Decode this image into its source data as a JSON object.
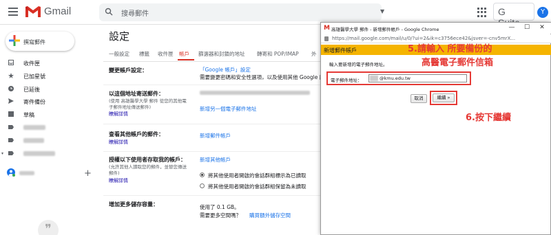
{
  "app": {
    "name": "Gmail",
    "suite_label": "G Suite",
    "avatar_letter": "Y"
  },
  "search": {
    "placeholder": "搜尋郵件"
  },
  "compose": {
    "label": "撰寫郵件"
  },
  "sidebar": {
    "items": [
      {
        "label": "收件匣",
        "icon": "inbox-icon"
      },
      {
        "label": "已加星號",
        "icon": "star-icon"
      },
      {
        "label": "已延後",
        "icon": "clock-icon"
      },
      {
        "label": "寄件備份",
        "icon": "send-icon"
      },
      {
        "label": "草稿",
        "icon": "draft-icon"
      }
    ]
  },
  "settings": {
    "title": "設定",
    "tabs": [
      "一般設定",
      "標籤",
      "收件匣",
      "帳戶",
      "篩選器和封鎖的地址",
      "轉寄和 POP/IMAP",
      "外"
    ],
    "active_tab": "帳戶",
    "rows": {
      "change": {
        "label": "變更帳戶設定：",
        "link": "「Google 帳戶」設定",
        "desc": "需要變更密碼和安全性選項，以及使用其他 Google 服"
      },
      "sendas": {
        "label": "以這個地址寄送郵件：",
        "sub1": "(使用 高雄醫學大學 郵件 從您的其他電",
        "sub2": "子郵件地址傳送郵件)",
        "learn": "瞭解詳情",
        "action": "新增另一個電子郵件地址"
      },
      "check": {
        "label": "查看其他帳戶的郵件：",
        "learn": "瞭解詳情",
        "action": "新增郵件帳戶"
      },
      "grant": {
        "label": "授權以下使用者存取我的帳戶：",
        "sub1": "(允許其他人讀取您的郵件，並替您傳送",
        "sub2": "郵件)",
        "learn": "瞭解詳情",
        "action": "新增其他帳戶",
        "opt1": "將其他使用者開啟的會話群組標示為已讀取",
        "opt2": "將其他使用者開啟的會話群組保留為未讀取"
      },
      "storage": {
        "label": "增加更多儲存容量：",
        "used": "使用了 0.1 GB。",
        "need": "需要更多空間嗎？",
        "buy": "購買額外儲存空間"
      }
    }
  },
  "popup": {
    "title": "高雄醫學大學 郵件 - 新增郵件帳戶 - Google Chrome",
    "url": "https://mail.google.com/mail/u/0/?ui=2&ik=c3756ece42&jsver=-cnv5mrX...",
    "header": "新增郵件帳戶",
    "instruction": "輸入要新增的電子郵件地址。",
    "email_label": "電子郵件地址：",
    "email_value": "@kmu.edu.tw",
    "cancel": "取消",
    "next": "繼續 »"
  },
  "annotations": {
    "step5_line1": "5.請輸入 所要備份的",
    "step5_line2": "高醫電子郵件信箱",
    "step6": "6.按下繼續"
  },
  "colors": {
    "accent_red": "#d93025",
    "popup_header": "#f5b400",
    "annotation": "#e53935",
    "link": "#1a0dab"
  }
}
